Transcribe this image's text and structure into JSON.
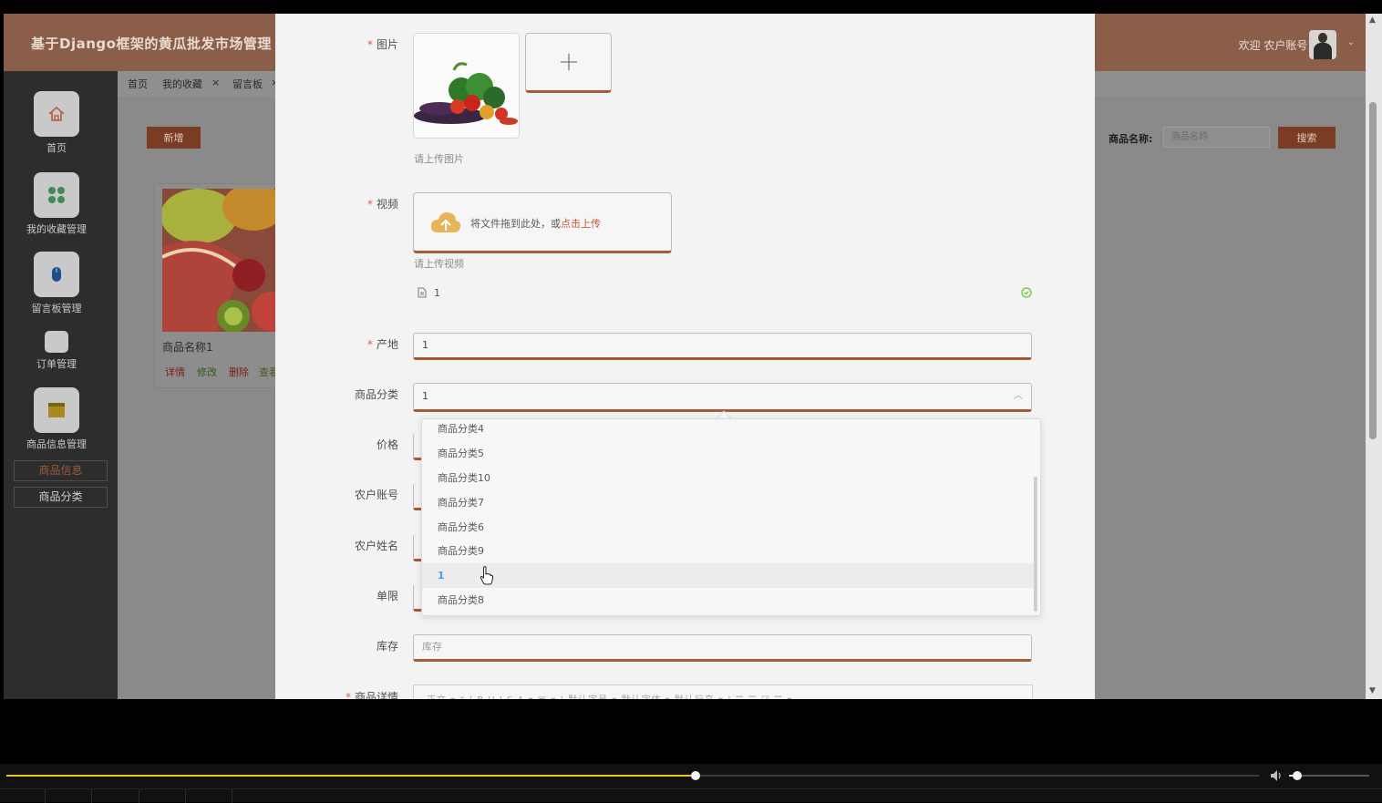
{
  "header": {
    "app_title": "基于Django框架的黄瓜批发市场管理",
    "welcome": "欢迎 农户账号1"
  },
  "sidebar": {
    "items": [
      {
        "label": "首页",
        "icon": "home-icon"
      },
      {
        "label": "我的收藏管理",
        "icon": "grid-icon"
      },
      {
        "label": "留言板管理",
        "icon": "mouse-icon"
      },
      {
        "label": "订单管理",
        "icon": "order-icon"
      },
      {
        "label": "商品信息管理",
        "icon": "box-icon"
      }
    ],
    "sub_items": [
      {
        "label": "商品信息",
        "active": true
      },
      {
        "label": "商品分类",
        "active": false
      }
    ]
  },
  "tabs": [
    {
      "label": "首页"
    },
    {
      "label": "我的收藏",
      "close": "×"
    },
    {
      "label": "留言板",
      "close": "×"
    }
  ],
  "list_page": {
    "add_label": "新增",
    "search_label": "商品名称:",
    "search_placeholder": "商品名称",
    "search_button": "搜索",
    "card": {
      "name": "商品名称1",
      "actions": [
        "详情",
        "修改",
        "删除",
        "查看"
      ]
    }
  },
  "form": {
    "image": {
      "label": "图片",
      "hint": "请上传图片"
    },
    "video": {
      "label": "视频",
      "drop_text": "将文件拖到此处，或",
      "drop_link": "点击上传",
      "hint": "请上传视频",
      "file_name": "1"
    },
    "origin": {
      "label": "产地",
      "value": "1"
    },
    "category": {
      "label": "商品分类",
      "value": "1"
    },
    "price": {
      "label": "价格"
    },
    "farmer_account": {
      "label": "农户账号"
    },
    "farmer_name": {
      "label": "农户姓名"
    },
    "limit": {
      "label": "单限"
    },
    "stock": {
      "label": "库存",
      "placeholder": "库存"
    },
    "details": {
      "label": "商品详情",
      "toolbar": "正文 ▾  “  |  B   U   I   S   A ▾  ▣ ▾  |  默认字号 ▾  默认字体 ▾  默认行高 ▾  |  ☰  ☰  ☑  ☰ ▾"
    }
  },
  "dropdown": {
    "options": [
      "商品分类4",
      "商品分类5",
      "商品分类10",
      "商品分类7",
      "商品分类6",
      "商品分类9",
      "1",
      "商品分类8"
    ],
    "selected_index": 6
  },
  "player": {
    "progress": 0.55,
    "volume": 0.1
  },
  "colors": {
    "accent": "#a65a36",
    "header": "#8a5e48",
    "selected": "#409eff",
    "success": "#67c23a"
  }
}
